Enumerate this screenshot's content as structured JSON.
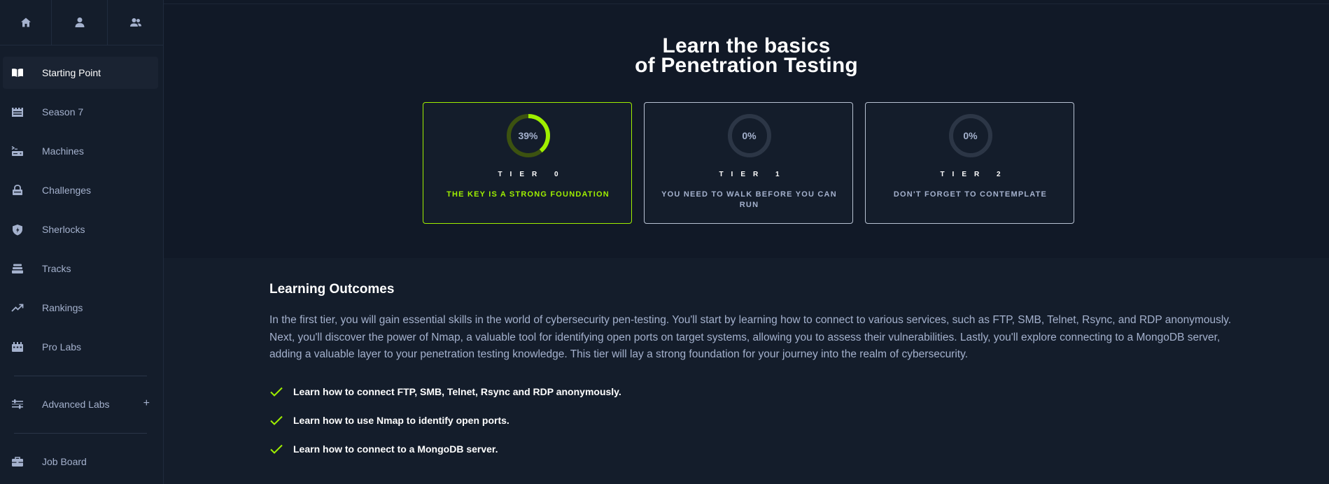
{
  "colors": {
    "accent": "#9fef00",
    "bg": "#111927",
    "panel": "#141d2b",
    "muted": "#a4b1cd"
  },
  "sidebar": {
    "top_buttons": [
      {
        "icon": "home-icon"
      },
      {
        "icon": "user-icon"
      },
      {
        "icon": "team-icon"
      }
    ],
    "items": [
      {
        "label": "Starting Point",
        "icon": "book-icon",
        "active": true
      },
      {
        "label": "Season 7",
        "icon": "castle-icon"
      },
      {
        "label": "Machines",
        "icon": "server-terminal-icon"
      },
      {
        "label": "Challenges",
        "icon": "lock-icon"
      },
      {
        "label": "Sherlocks",
        "icon": "shield-icon"
      },
      {
        "label": "Tracks",
        "icon": "stack-icon"
      },
      {
        "label": "Rankings",
        "icon": "trend-up-icon"
      },
      {
        "label": "Pro Labs",
        "icon": "lab-icon"
      },
      {
        "label": "Advanced Labs",
        "icon": "sliders-icon",
        "expand": "+"
      },
      {
        "label": "Job Board",
        "icon": "briefcase-icon"
      }
    ]
  },
  "hero": {
    "title_line1": "Learn the basics",
    "title_line2": "of Penetration Testing"
  },
  "tiers": [
    {
      "percent_label": "39%",
      "progress": 0.39,
      "tier_label": "TIER 0",
      "subtitle": "THE KEY IS A STRONG FOUNDATION",
      "active": true
    },
    {
      "percent_label": "0%",
      "progress": 0,
      "tier_label": "TIER 1",
      "subtitle": "YOU NEED TO WALK BEFORE YOU CAN RUN"
    },
    {
      "percent_label": "0%",
      "progress": 0,
      "tier_label": "TIER 2",
      "subtitle": "DON'T FORGET TO CONTEMPLATE"
    }
  ],
  "outcomes": {
    "title": "Learning Outcomes",
    "description": "In the first tier, you will gain essential skills in the world of cybersecurity pen-testing. You'll start by learning how to connect to various services, such as FTP, SMB, Telnet, Rsync, and RDP anonymously. Next, you'll discover the power of Nmap, a valuable tool for identifying open ports on target systems, allowing you to assess their vulnerabilities. Lastly, you'll explore connecting to a MongoDB server, adding a valuable layer to your penetration testing knowledge. This tier will lay a strong foundation for your journey into the realm of cybersecurity.",
    "items": [
      "Learn how to connect FTP, SMB, Telnet, Rsync and RDP anonymously.",
      "Learn how to use Nmap to identify open ports.",
      "Learn how to connect to a MongoDB server."
    ]
  }
}
